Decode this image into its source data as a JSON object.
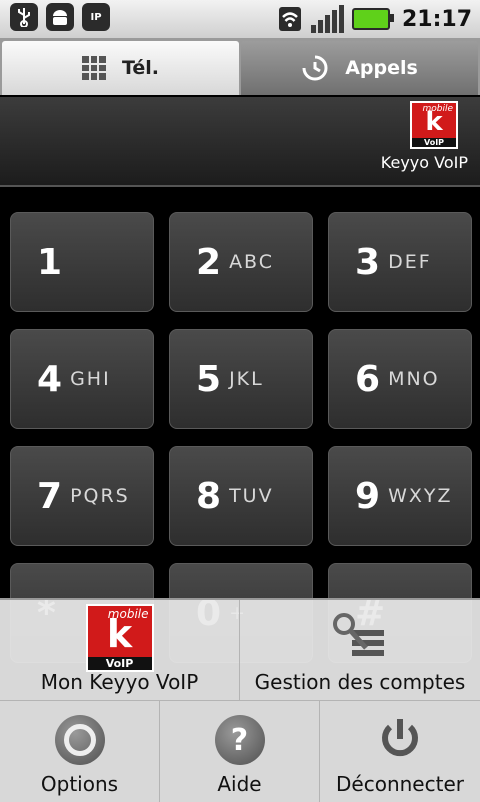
{
  "status_bar": {
    "time": "21:17",
    "left_icons": [
      "usb-icon",
      "android-debug-icon",
      "sip-call-icon"
    ],
    "sip_icon_text": "IP"
  },
  "tabs": [
    {
      "label": "Tél.",
      "icon": "dialpad-icon",
      "active": true
    },
    {
      "label": "Appels",
      "icon": "call-log-icon",
      "active": false
    }
  ],
  "display": {
    "number": "",
    "provider_name": "Keyyo VoIP",
    "logo": {
      "top": "mobile",
      "letter": "k",
      "bottom": "VoIP"
    }
  },
  "keys": [
    {
      "digit": "1",
      "letters": ""
    },
    {
      "digit": "2",
      "letters": "ABC"
    },
    {
      "digit": "3",
      "letters": "DEF"
    },
    {
      "digit": "4",
      "letters": "GHI"
    },
    {
      "digit": "5",
      "letters": "JKL"
    },
    {
      "digit": "6",
      "letters": "MNO"
    },
    {
      "digit": "7",
      "letters": "PQRS"
    },
    {
      "digit": "8",
      "letters": "TUV"
    },
    {
      "digit": "9",
      "letters": "WXYZ"
    },
    {
      "digit": "*",
      "letters": ""
    },
    {
      "digit": "0",
      "letters": "+"
    },
    {
      "digit": "#",
      "letters": ""
    }
  ],
  "menu": {
    "row1": [
      {
        "label": "Mon Keyyo VoIP",
        "icon": "keyyo-logo-icon"
      },
      {
        "label": "Gestion des comptes",
        "icon": "accounts-settings-icon"
      }
    ],
    "row2": [
      {
        "label": "Options",
        "icon": "options-icon"
      },
      {
        "label": "Aide",
        "icon": "help-icon",
        "glyph": "?"
      },
      {
        "label": "Déconnecter",
        "icon": "power-icon"
      }
    ]
  },
  "colors": {
    "keyyo_red": "#d11a1a",
    "battery_green": "#5fd11a"
  }
}
